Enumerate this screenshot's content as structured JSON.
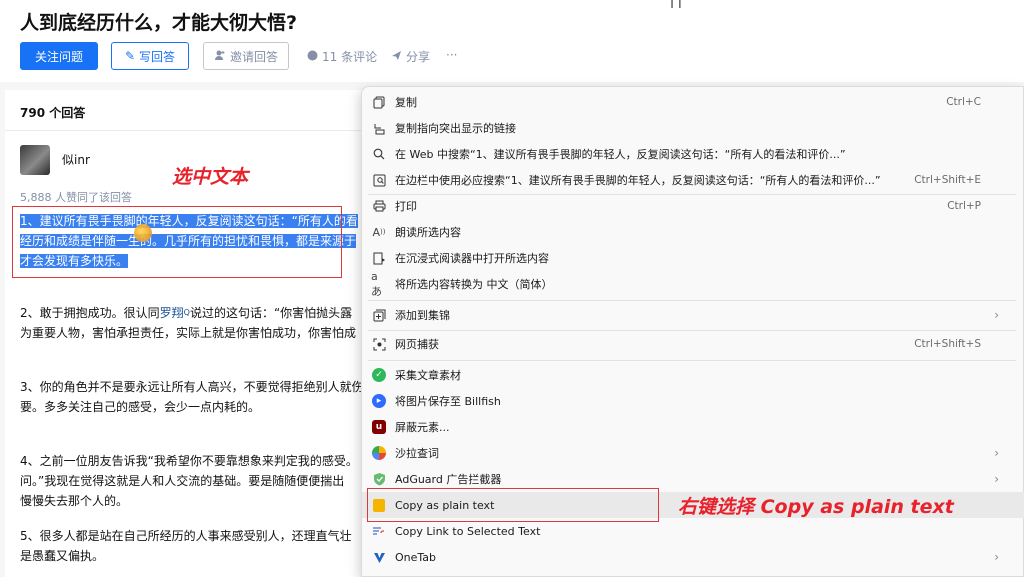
{
  "header": {
    "question_title": "人到底经历什么，才能大彻大悟?",
    "top_right_fragment": "| |",
    "follow_label": "关注问题",
    "write_label": "写回答",
    "invite_label": "邀请回答",
    "comments_label": "11 条评论",
    "share_label": "分享",
    "more_label": "···"
  },
  "answers": {
    "count_label": "790 个回答",
    "author_name": "似inr",
    "votes_label": "5,888 人赞同了该回答",
    "selected_lines": [
      "1、建议所有畏手畏脚的年轻人，反复阅读这句话：“所有人的看",
      "经历和成绩是伴随一生的。几乎所有的担忧和畏惧，都是来源于",
      "才会发现有多快乐。"
    ],
    "para2": [
      "2、敢于拥抱成功。很认同",
      "罗翔",
      "说过的这句话：“你害怕抛头露",
      "为重要人物，害怕承担责任，实际上就是你害怕成功，你害怕成"
    ],
    "para3": [
      "3、你的角色并不是要永远让所有人高兴，不要觉得拒绝别人就伤",
      "要。多多关注自己的感受，会少一点内耗的。"
    ],
    "para4": [
      "4、之前一位朋友告诉我“我希望你不要靠想象来判定我的感受。",
      "问。”我现在觉得这就是人和人交流的基础。要是随随便便揣出",
      "慢慢失去那个人的。"
    ],
    "para5": [
      "5、很多人都是站在自己所经历的人事来感受别人，还理直气壮",
      "是愚蠢又偏执。"
    ]
  },
  "annotations": {
    "select_text": "选中文本",
    "right_click_text": "右键选择 Copy as plain text"
  },
  "menu": {
    "items": [
      {
        "icon": "copy-icon",
        "label": "复制",
        "shortcut": "Ctrl+C"
      },
      {
        "icon": "link-highlight-icon",
        "label": "复制指向突出显示的链接",
        "shortcut": ""
      },
      {
        "icon": "search-icon",
        "label": "在 Web 中搜索“1、建议所有畏手畏脚的年轻人，反复阅读这句话：“所有人的看法和评价...”",
        "shortcut": ""
      },
      {
        "icon": "sidebar-search-icon",
        "label": "在边栏中使用必应搜索“1、建议所有畏手畏脚的年轻人，反复阅读这句话：“所有人的看法和评价...”",
        "shortcut": "Ctrl+Shift+E"
      },
      {
        "icon": "print-icon",
        "label": "打印",
        "shortcut": "Ctrl+P"
      },
      {
        "icon": "read-aloud-icon",
        "label": "朗读所选内容",
        "shortcut": ""
      },
      {
        "icon": "immersive-reader-icon",
        "label": "在沉浸式阅读器中打开所选内容",
        "shortcut": ""
      },
      {
        "icon": "translate-icon",
        "label": "将所选内容转换为 中文（简体）",
        "shortcut": ""
      },
      {
        "icon": "collections-icon",
        "label": "添加到集锦",
        "shortcut": ""
      },
      {
        "icon": "web-capture-icon",
        "label": "网页捕获",
        "shortcut": "Ctrl+Shift+S"
      },
      {
        "icon": "collect-article-icon",
        "label": "采集文章素材",
        "shortcut": ""
      },
      {
        "icon": "billfish-icon",
        "label": "将图片保存至 Billfish",
        "shortcut": ""
      },
      {
        "icon": "ublock-icon",
        "label": "屏蔽元素...",
        "shortcut": ""
      },
      {
        "icon": "salad-dict-icon",
        "label": "沙拉查词",
        "shortcut": ""
      },
      {
        "icon": "adguard-icon",
        "label": "AdGuard 广告拦截器",
        "shortcut": ""
      },
      {
        "icon": "copy-plain-text-icon",
        "label": "Copy as plain text",
        "shortcut": ""
      },
      {
        "icon": "copy-link-icon",
        "label": "Copy Link to Selected Text",
        "shortcut": ""
      },
      {
        "icon": "onetab-icon",
        "label": "OneTab",
        "shortcut": ""
      }
    ]
  },
  "colors": {
    "accent": "#1772f6",
    "selection": "#3a80f0",
    "annotation_red": "#e8212b"
  }
}
